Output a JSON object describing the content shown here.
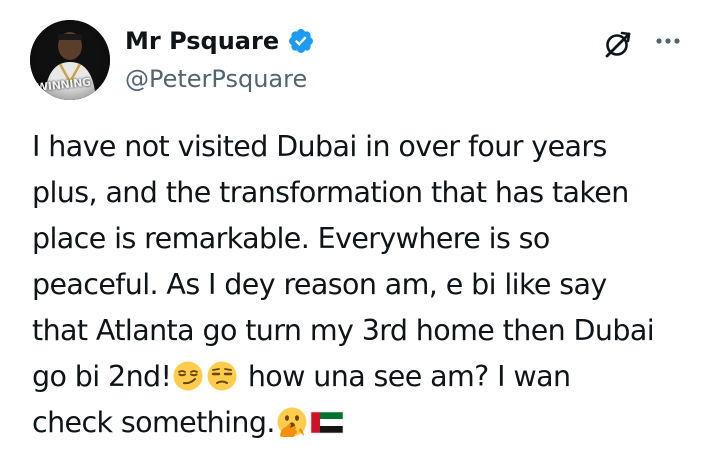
{
  "author": {
    "display_name": "Mr Psquare",
    "handle": "@PeterPsquare",
    "verified": true,
    "avatar_caption": "WINNING"
  },
  "icons": {
    "verified": "verified-badge-icon",
    "grok": "grok-icon",
    "more": "more-options-icon"
  },
  "tweet": {
    "lines": [
      "I have not visited Dubai in over four years",
      "plus, and the transformation that has taken",
      "place is remarkable. Everywhere is so",
      "peaceful. As I dey reason am, e bi like say",
      "that Atlanta go turn my 3rd home then Dubai"
    ],
    "line6_start": "go bi 2nd!",
    "line6_end": " how una see am?  I wan",
    "line7_start": "check something.",
    "emojis": [
      "smirking-face",
      "unamused-face",
      "face-with-open-eyes-and-hand-over-mouth",
      "uae-flag"
    ]
  },
  "colors": {
    "text": "#0f1419",
    "secondary": "#536471",
    "verified_blue": "#1d9bf0"
  }
}
